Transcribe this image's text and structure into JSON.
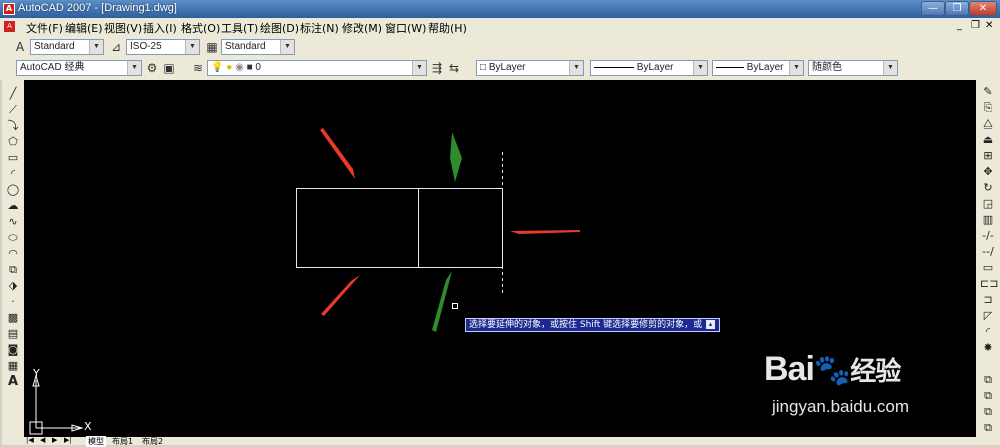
{
  "window": {
    "title": "AutoCAD 2007 - [Drawing1.dwg]",
    "app_icon": "autocad-a-icon"
  },
  "menu": [
    "文件(F)",
    "编辑(E)",
    "视图(V)",
    "插入(I)",
    "格式(O)",
    "工具(T)",
    "绘图(D)",
    "标注(N)",
    "修改(M)",
    "窗口(W)",
    "帮助(H)"
  ],
  "styles_toolbar": {
    "text_style": "Standard",
    "dim_style": "ISO-25",
    "table_style": "Standard"
  },
  "workspace_toolbar": {
    "workspace": "AutoCAD 经典",
    "layer": "0"
  },
  "properties_toolbar": {
    "color": "ByLayer",
    "linetype": "ByLayer",
    "lineweight": "ByLayer",
    "plot_style": "随颜色"
  },
  "command": {
    "tooltip": "选择要延伸的对象，或按住 Shift 键选择要修剪的对象，或"
  },
  "ucs": {
    "x_label": "X",
    "y_label": "Y"
  },
  "tabs": [
    "模型",
    "布局1",
    "布局2"
  ],
  "watermark": {
    "brand": "Bai",
    "brand_cn": "经验",
    "url": "jingyan.baidu.com"
  },
  "colors": {
    "canvas": "#000000",
    "arrow_red": "#e8392b",
    "arrow_green": "#2e8b2e",
    "tooltip_bg": "#1a2a8e"
  }
}
